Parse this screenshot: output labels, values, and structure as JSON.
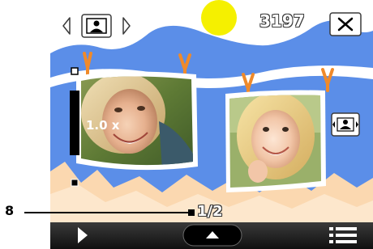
{
  "viewer": {
    "photo_counter": "3197",
    "zoom_level": "1.0 x",
    "page_indicator": "1/2",
    "zoom_fraction": 0.55
  },
  "annotation": {
    "callout_number": "8"
  },
  "toolbar": {
    "play_icon": "play-icon",
    "up_icon": "chevron-up-icon",
    "menu_icon": "list-menu-icon"
  },
  "colors": {
    "sky": "#5b8ee8",
    "cloud": "#ffffff",
    "sun": "#f5f000",
    "sand": "#fbd8b0",
    "toolbar": "#1a1a1a"
  }
}
